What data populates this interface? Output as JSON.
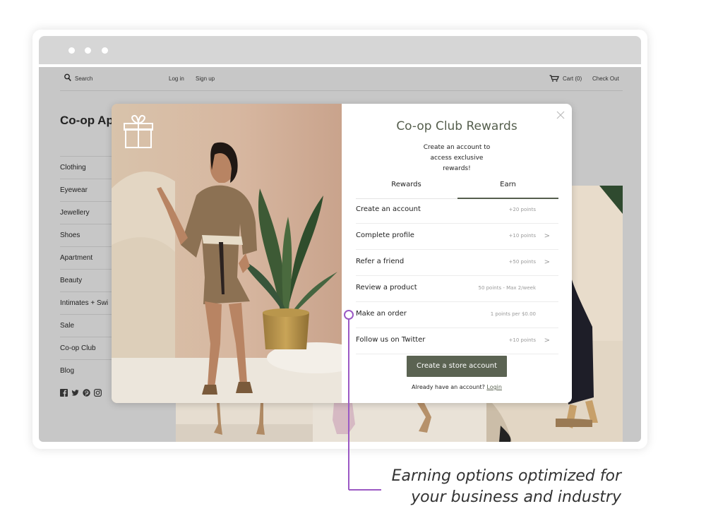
{
  "browser": {
    "window_controls": [
      "dot",
      "dot",
      "dot"
    ]
  },
  "store": {
    "search_label": "Search",
    "login_label": "Log in",
    "signup_label": "Sign up",
    "cart_label": "Cart (0)",
    "checkout_label": "Check Out",
    "title": "Co-op Ap",
    "sidebar": [
      "Clothing",
      "Eyewear",
      "Jewellery",
      "Shoes",
      "Apartment",
      "Beauty",
      "Intimates + Swi",
      "Sale",
      "Co-op Club",
      "Blog"
    ],
    "social_icons": [
      "facebook-icon",
      "twitter-icon",
      "pinterest-icon",
      "instagram-icon"
    ]
  },
  "modal": {
    "title": "Co-op Club Rewards",
    "subtitle": "Create an account to access exclusive rewards!",
    "tabs": [
      {
        "label": "Rewards",
        "active": false
      },
      {
        "label": "Earn",
        "active": true
      }
    ],
    "earn_items": [
      {
        "label": "Create an account",
        "points": "+20 points",
        "chevron": false
      },
      {
        "label": "Complete profile",
        "points": "+10 points",
        "chevron": true
      },
      {
        "label": "Refer a friend",
        "points": "+50 points",
        "chevron": true
      },
      {
        "label": "Review a product",
        "points": "50 points - Max 2/week",
        "chevron": false
      },
      {
        "label": "Make an order",
        "points": "1 points per $0.00",
        "chevron": false
      },
      {
        "label": "Follow us on Twitter",
        "points": "+10 points",
        "chevron": true
      }
    ],
    "cta_label": "Create a store account",
    "login_prompt": "Already have an account?",
    "login_link": "Login",
    "chevron_glyph": ">",
    "gift_icon": "gift-icon",
    "close_icon": "close-icon"
  },
  "annotation": {
    "line1": "Earning options optimized for",
    "line2": "your business and industry",
    "accent_color": "#9b59c4"
  },
  "colors": {
    "brand_green": "#5b6352",
    "page_background": "#c7c7c7"
  }
}
